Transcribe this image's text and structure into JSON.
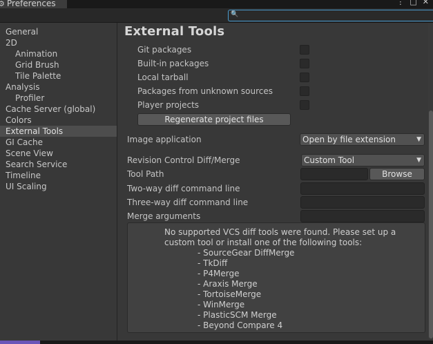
{
  "window": {
    "tab_title": "Preferences",
    "gear_icon": "gear-icon",
    "menu_icon": "⋮",
    "maximize_icon": "□",
    "close_icon": "✕"
  },
  "search": {
    "value": "",
    "placeholder": ""
  },
  "sidebar": {
    "items": [
      {
        "label": "General",
        "indent": 0,
        "selected": false
      },
      {
        "label": "2D",
        "indent": 0,
        "selected": false
      },
      {
        "label": "Animation",
        "indent": 1,
        "selected": false
      },
      {
        "label": "Grid Brush",
        "indent": 1,
        "selected": false
      },
      {
        "label": "Tile Palette",
        "indent": 1,
        "selected": false
      },
      {
        "label": "Analysis",
        "indent": 0,
        "selected": false
      },
      {
        "label": "Profiler",
        "indent": 1,
        "selected": false
      },
      {
        "label": "Cache Server (global)",
        "indent": 0,
        "selected": false
      },
      {
        "label": "Colors",
        "indent": 0,
        "selected": false
      },
      {
        "label": "External Tools",
        "indent": 0,
        "selected": true
      },
      {
        "label": "GI Cache",
        "indent": 0,
        "selected": false
      },
      {
        "label": "Scene View",
        "indent": 0,
        "selected": false
      },
      {
        "label": "Search Service",
        "indent": 0,
        "selected": false
      },
      {
        "label": "Timeline",
        "indent": 0,
        "selected": false
      },
      {
        "label": "UI Scaling",
        "indent": 0,
        "selected": false
      }
    ]
  },
  "main": {
    "title": "External Tools",
    "packages": [
      {
        "label": "Git packages",
        "checked": false
      },
      {
        "label": "Built-in packages",
        "checked": false
      },
      {
        "label": "Local tarball",
        "checked": false
      },
      {
        "label": "Packages from unknown sources",
        "checked": false
      },
      {
        "label": "Player projects",
        "checked": false
      }
    ],
    "regenerate_label": "Regenerate project files",
    "image_application": {
      "label": "Image application",
      "value": "Open by file extension"
    },
    "revision_control": {
      "label": "Revision Control Diff/Merge",
      "value": "Custom Tool"
    },
    "tool_path": {
      "label": "Tool Path",
      "value": "",
      "browse_label": "Browse"
    },
    "two_way": {
      "label": "Two-way diff command line",
      "value": ""
    },
    "three_way": {
      "label": "Three-way diff command line",
      "value": ""
    },
    "merge_args": {
      "label": "Merge arguments",
      "value": ""
    },
    "help": {
      "message": "No supported VCS diff tools were found. Please set up a custom tool or install one of the following tools:",
      "tools": [
        "- SourceGear DiffMerge",
        "- TkDiff",
        "- P4Merge",
        "- Araxis Merge",
        "- TortoiseMerge",
        "- WinMerge",
        "- PlasticSCM Merge",
        "- Beyond Compare 4"
      ]
    }
  },
  "colors": {
    "background": "#383838",
    "selected_item": "#4d4d4d",
    "search_focus": "#4a9cd0",
    "status_accent": "#6a55b8"
  }
}
